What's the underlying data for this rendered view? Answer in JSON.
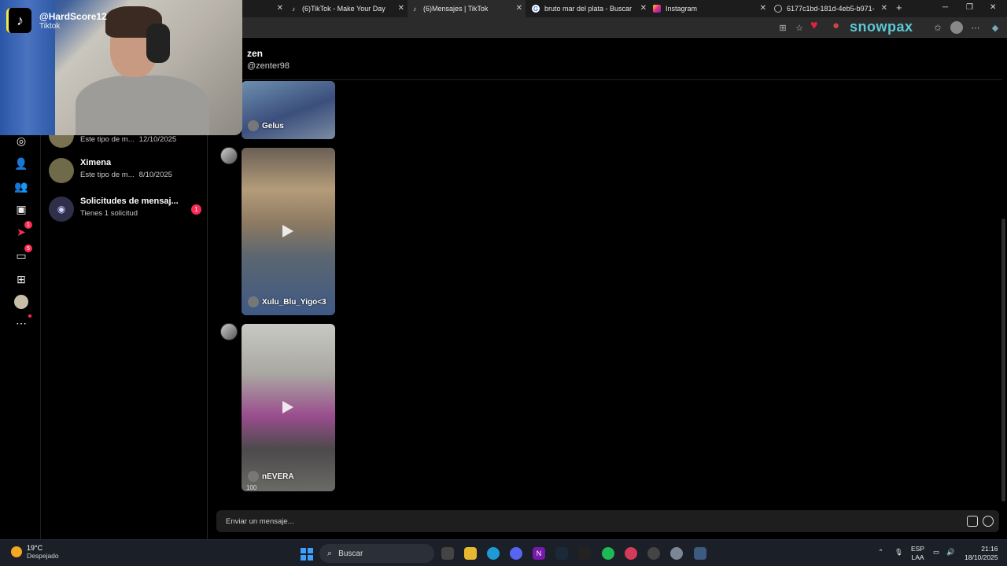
{
  "browser": {
    "tabs": [
      {
        "label": "(6)TikTok - Make Your Day",
        "favicon": "tiktok-favicon"
      },
      {
        "label": "(6)Mensajes | TikTok",
        "favicon": "tiktok-favicon",
        "active": true
      },
      {
        "label": "bruto mar del plata - Buscar co",
        "favicon": "google-favicon"
      },
      {
        "label": "Instagram",
        "favicon": "instagram-favicon"
      },
      {
        "label": "6177c1bd-181d-4eb5-b971-c8",
        "favicon": "globe-favicon"
      }
    ],
    "new_tab": "+",
    "extension_text": "snowpax"
  },
  "overlay": {
    "handle": "@HardScore12",
    "platform": "Tiktok"
  },
  "rail": {
    "badges": {
      "activity": "1",
      "messages": "5"
    }
  },
  "conversations": [
    {
      "name": "",
      "preview": "Este tipo de m...",
      "date": "12/10/2025"
    },
    {
      "name": "Ximena",
      "preview": "Este tipo de m...",
      "date": "8/10/2025"
    },
    {
      "name": "Solicitudes de mensaj...",
      "preview": "Tienes 1 solicitud",
      "date": "",
      "unread": "1"
    }
  ],
  "chat": {
    "name": "zen",
    "handle": "@zenter98",
    "videos": [
      {
        "author": "Gelus",
        "count": ""
      },
      {
        "author": "Xulu_Blu_Yigo<3",
        "count": ""
      },
      {
        "author": "nEVERA",
        "count": "100"
      }
    ],
    "composer_placeholder": "Enviar un mensaje..."
  },
  "taskbar": {
    "weather_temp": "19°C",
    "weather_cond": "Despejado",
    "search_label": "Buscar",
    "lang": "ESP",
    "lang_sub": "LAA",
    "time": "21:16",
    "date": "18/10/2025"
  },
  "colors": {
    "accent": "#fe2c55",
    "background": "#000000",
    "taskbar": "#1b1f27"
  }
}
